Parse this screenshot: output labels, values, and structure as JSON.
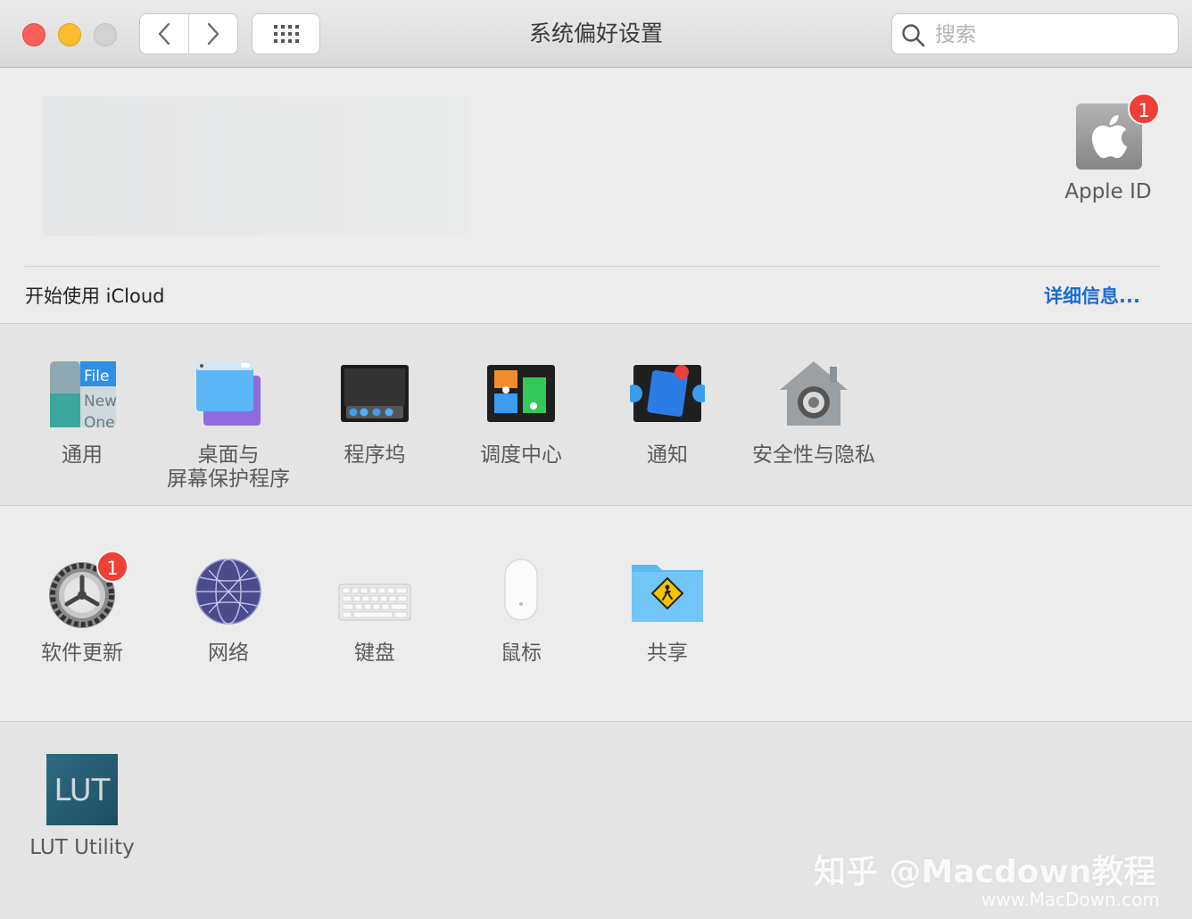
{
  "window": {
    "title": "系统偏好设置"
  },
  "search": {
    "placeholder": "搜索"
  },
  "apple_id": {
    "label": "Apple ID",
    "badge": "1"
  },
  "icloud": {
    "prompt": "开始使用 iCloud",
    "details_link": "详细信息..."
  },
  "row1": [
    {
      "label": "通用",
      "icon": "general-icon"
    },
    {
      "label": "桌面与\n屏幕保护程序",
      "icon": "desktop-screensaver-icon"
    },
    {
      "label": "程序坞",
      "icon": "dock-icon"
    },
    {
      "label": "调度中心",
      "icon": "mission-control-icon"
    },
    {
      "label": "通知",
      "icon": "notifications-icon"
    },
    {
      "label": "安全性与隐私",
      "icon": "security-privacy-icon"
    }
  ],
  "row2": [
    {
      "label": "软件更新",
      "icon": "software-update-icon",
      "badge": "1"
    },
    {
      "label": "网络",
      "icon": "network-icon"
    },
    {
      "label": "键盘",
      "icon": "keyboard-icon"
    },
    {
      "label": "鼠标",
      "icon": "mouse-icon"
    },
    {
      "label": "共享",
      "icon": "sharing-icon"
    }
  ],
  "row3": [
    {
      "label": "LUT Utility",
      "icon": "lut-utility-icon",
      "icon_text": "LUT"
    }
  ],
  "general_icon_text": {
    "file": "File",
    "new": "New",
    "open": "One"
  },
  "watermark": {
    "main": "知乎 @Macdown教程",
    "url": "www.MacDown.com"
  },
  "colors": {
    "link": "#1a6cd3",
    "badge": "#ee3f38",
    "close": "#fc5f57",
    "minimize": "#fdbc2e"
  }
}
